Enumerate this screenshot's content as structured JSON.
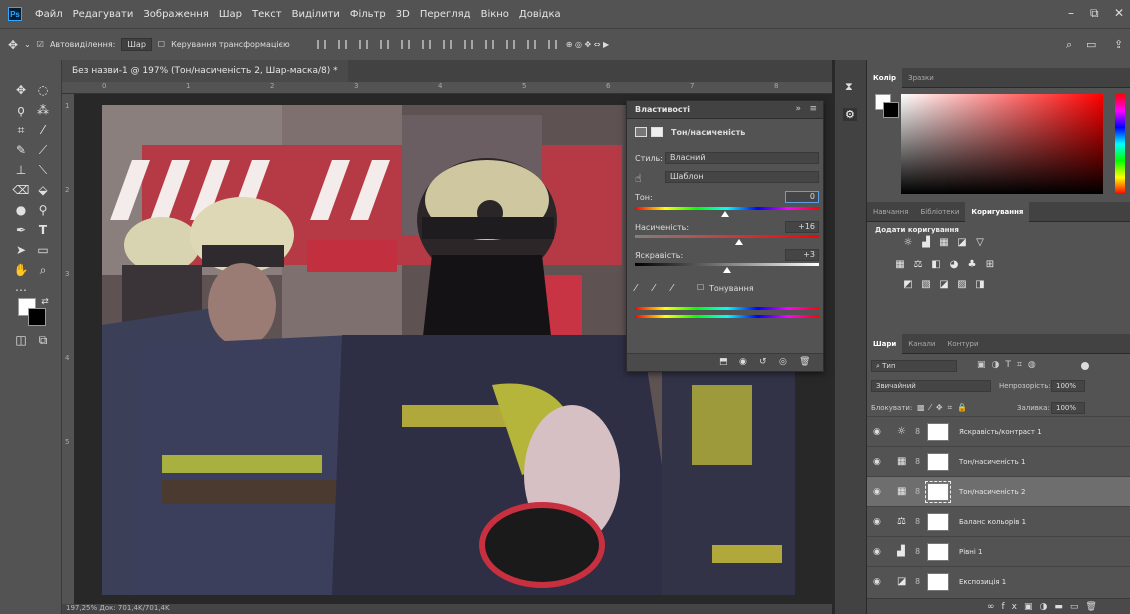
{
  "menubar": {
    "logo": "Ps",
    "items": [
      "Файл",
      "Редагувати",
      "Зображення",
      "Шар",
      "Текст",
      "Виділити",
      "Фільтр",
      "3D",
      "Перегляд",
      "Вікно",
      "Довідка"
    ],
    "window_controls": [
      "–",
      "⧉",
      "✕"
    ]
  },
  "optionsbar": {
    "auto_select_label": "Автовиділення:",
    "auto_select_value": "Шар",
    "transform_label": "Керування трансформацією"
  },
  "document": {
    "tab_title": "Без назви-1 @ 197% (Тон/насиченість 2, Шар-маска/8) *",
    "ruler_top": [
      "0",
      "1",
      "2",
      "3",
      "4",
      "5",
      "6",
      "7",
      "8"
    ],
    "ruler_left": [
      "1",
      "2",
      "3",
      "4",
      "5"
    ],
    "status": "197,25%      Док: 701,4K/701,4K"
  },
  "properties": {
    "tab_label": "Властивості",
    "type_label": "Тон/насиченість",
    "style_label": "Стиль:",
    "style_value": "Власний",
    "channel_value": "Шаблон",
    "hue_label": "Тон:",
    "hue_value": "0",
    "saturation_label": "Насиченість:",
    "saturation_value": "+16",
    "lightness_label": "Яскравість:",
    "lightness_value": "+3",
    "colorize_label": "Тонування"
  },
  "right_panels": {
    "color_tabs": [
      "Колір",
      "Зразки"
    ],
    "adjust_tabs": [
      "Навчання",
      "Бібліотеки",
      "Коригування"
    ],
    "adjust_add_label": "Додати коригування",
    "layers_tabs": [
      "Шари",
      "Канали",
      "Контури"
    ],
    "filter_value": "Тип",
    "blend_mode": "Звичайний",
    "opacity_label": "Непрозорість:",
    "opacity_value": "100%",
    "lock_label": "Блокувати:",
    "fill_label": "Заливка:",
    "fill_value": "100%"
  },
  "layers": [
    {
      "name": "Яскравість/контраст 1",
      "icon": "brightness-contrast-icon",
      "glyph": "☼",
      "selected": false
    },
    {
      "name": "Тон/насиченість 1",
      "icon": "hue-saturation-icon",
      "glyph": "▦",
      "selected": false
    },
    {
      "name": "Тон/насиченість 2",
      "icon": "hue-saturation-icon",
      "glyph": "▦",
      "selected": true
    },
    {
      "name": "Баланс кольорів 1",
      "icon": "color-balance-icon",
      "glyph": "⚖",
      "selected": false
    },
    {
      "name": "Рівні 1",
      "icon": "levels-icon",
      "glyph": "▟",
      "selected": false
    },
    {
      "name": "Експозиція 1",
      "icon": "exposure-icon",
      "glyph": "◪",
      "selected": false
    }
  ],
  "colors": {
    "accent": "#31a8ff",
    "panel": "#535353",
    "dark": "#424242"
  }
}
